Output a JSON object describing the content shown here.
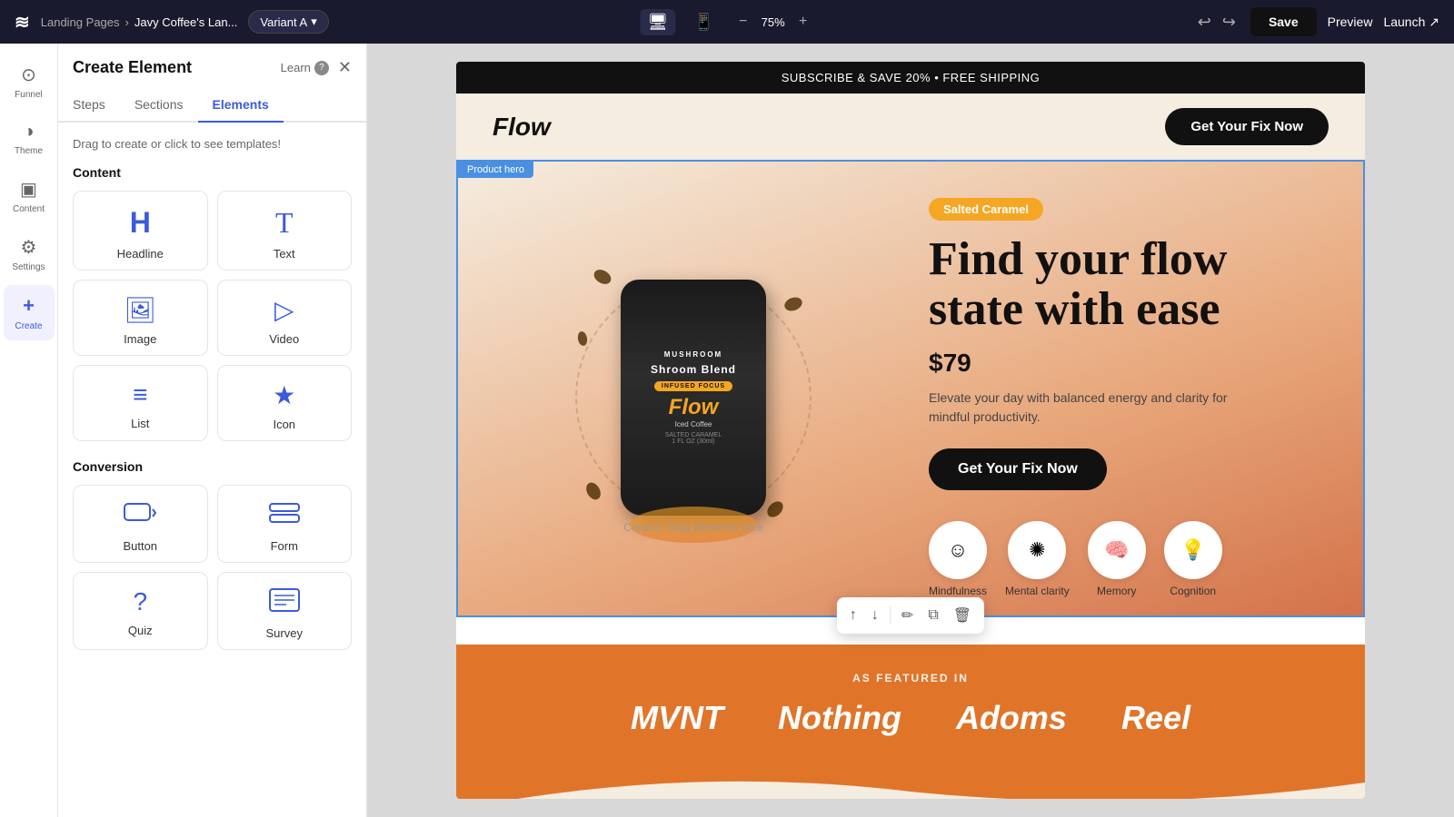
{
  "topbar": {
    "logo_text": "≋",
    "breadcrumb_root": "Landing Pages",
    "breadcrumb_sep": "›",
    "breadcrumb_current": "Javy Coffee's Lan...",
    "variant_label": "Variant A",
    "variant_chevron": "▾",
    "zoom_minus": "−",
    "zoom_value": "75%",
    "zoom_plus": "+",
    "undo_icon": "↩",
    "redo_icon": "↪",
    "save_label": "Save",
    "preview_label": "Preview",
    "launch_label": "Launch ↗"
  },
  "icon_nav": {
    "items": [
      {
        "id": "funnel",
        "icon": "⊙",
        "label": "Funnel",
        "active": false
      },
      {
        "id": "theme",
        "icon": "◑",
        "label": "Theme",
        "active": false
      },
      {
        "id": "content",
        "icon": "▣",
        "label": "Content",
        "active": false
      },
      {
        "id": "settings",
        "icon": "⚙",
        "label": "Settings",
        "active": false
      },
      {
        "id": "create",
        "icon": "+",
        "label": "Create",
        "active": true
      }
    ]
  },
  "panel": {
    "title": "Create Element",
    "learn_label": "Learn",
    "learn_icon": "?",
    "close_icon": "✕",
    "tabs": [
      {
        "id": "steps",
        "label": "Steps",
        "active": false
      },
      {
        "id": "sections",
        "label": "Sections",
        "active": false
      },
      {
        "id": "elements",
        "label": "Elements",
        "active": true
      }
    ],
    "hint": "Drag to create or click to see templates!",
    "content_section_label": "Content",
    "elements": [
      {
        "id": "headline",
        "icon": "H",
        "label": "Headline"
      },
      {
        "id": "text",
        "icon": "T",
        "label": "Text"
      },
      {
        "id": "image",
        "icon": "🖼",
        "label": "Image"
      },
      {
        "id": "video",
        "icon": "▷",
        "label": "Video"
      },
      {
        "id": "list",
        "icon": "≡",
        "label": "List"
      },
      {
        "id": "icon",
        "icon": "★",
        "label": "Icon"
      }
    ],
    "conversion_section_label": "Conversion",
    "conversion_elements": [
      {
        "id": "button",
        "icon": "☐→",
        "label": "Button"
      },
      {
        "id": "form",
        "icon": "▬▬",
        "label": "Form"
      },
      {
        "id": "quiz",
        "icon": "?",
        "label": "Quiz"
      },
      {
        "id": "survey",
        "icon": "≣",
        "label": "Survey"
      }
    ]
  },
  "canvas": {
    "promo_banner": "SUBSCRIBE & SAVE 20% • FREE SHIPPING",
    "page_logo": "Flow",
    "page_cta_label": "Get Your Fix Now",
    "hero_product_label": "Product hero",
    "hero_badge": "Salted Caramel",
    "hero_headline_line1": "Find your flow",
    "hero_headline_line2": "state with ease",
    "hero_price": "$79",
    "hero_desc": "Elevate your day with balanced energy and clarity for mindful productivity.",
    "hero_cta_label": "Get Your Fix Now",
    "column_drag_hint": "Column: Drag elements here",
    "can_top_text": "Shroom Blend",
    "can_brand_text": "Flow",
    "can_sub_text": "Iced Coffee",
    "benefits": [
      {
        "id": "mindfulness",
        "icon": "☺",
        "label": "Mindfulness"
      },
      {
        "id": "mental-clarity",
        "icon": "☀",
        "label": "Mental clarity"
      },
      {
        "id": "memory",
        "icon": "🧠",
        "label": "Memory"
      },
      {
        "id": "cognition",
        "icon": "💡",
        "label": "Cognition"
      }
    ],
    "featured_label": "AS FEATURED IN",
    "featured_brands": [
      {
        "id": "mvnt",
        "name": "MVNT"
      },
      {
        "id": "nothing",
        "name": "Nothing"
      },
      {
        "id": "adoms",
        "name": "Adoms"
      },
      {
        "id": "reel",
        "name": "Reel"
      }
    ]
  },
  "floating_toolbar": {
    "up_icon": "↑",
    "down_icon": "↓",
    "edit_icon": "✏",
    "copy_icon": "⧉",
    "delete_icon": "🗑"
  }
}
